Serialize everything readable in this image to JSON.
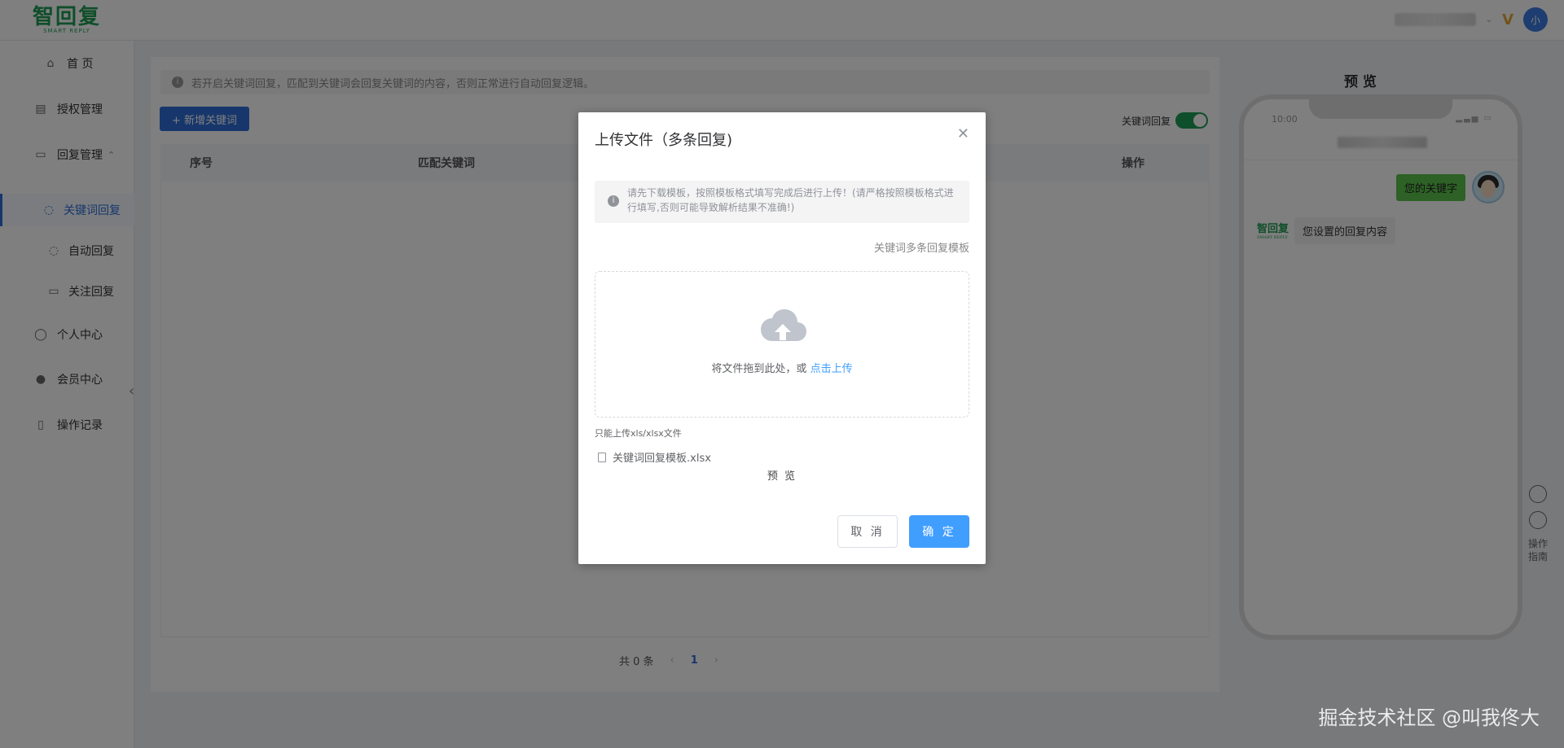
{
  "header": {
    "logo_text": "智回复",
    "logo_sub": "SMART REPLY",
    "avatar_text": "小"
  },
  "sidebar": {
    "items": [
      {
        "label": "首 页",
        "icon": "home-icon"
      },
      {
        "label": "授权管理",
        "icon": "document-icon"
      },
      {
        "label": "回复管理",
        "icon": "message-icon"
      },
      {
        "label": "关键词回复",
        "icon": "chat-icon"
      },
      {
        "label": "自动回复",
        "icon": "chat-icon"
      },
      {
        "label": "关注回复",
        "icon": "chat-icon"
      },
      {
        "label": "个人中心",
        "icon": "user-icon"
      },
      {
        "label": "会员中心",
        "icon": "member-icon"
      },
      {
        "label": "操作记录",
        "icon": "book-icon"
      }
    ]
  },
  "main": {
    "tip": "若开启关键词回复，匹配到关键词会回复关键词的内容，否则正常进行自动回复逻辑。",
    "add_button": "+ 新增关键词",
    "switch_label": "关键词回复",
    "table": {
      "col_index": "序号",
      "col_keyword": "匹配关键词",
      "col_action": "操作"
    },
    "pager": {
      "total": "共 0 条",
      "current": "1"
    }
  },
  "preview": {
    "title": "预 览",
    "time": "10:00",
    "msg_user": "您的关键字",
    "msg_reply": "您设置的回复内容",
    "logo_text": "智回复",
    "logo_sub": "SMART REPLY",
    "tool_label_1": "操作",
    "tool_label_2": "指南"
  },
  "dialog": {
    "title": "上传文件（多条回复)",
    "alert": "请先下载模板，按照模板格式填写完成后进行上传！(请严格按照模板格式进行填写,否则可能导致解析结果不准确!)",
    "template_link": "关键词多条回复模板",
    "drop_text": "将文件拖到此处，或 ",
    "drop_link": "点击上传",
    "hint": "只能上传xls/xlsx文件",
    "file_name": "关键词回复模板.xlsx",
    "preview": "预 览",
    "cancel": "取 消",
    "ok": "确 定"
  },
  "watermark": "掘金技术社区 @叫我佟大",
  "colors": {
    "primary": "#2f6fd8",
    "brand_green": "#1f9d55",
    "dialog_blue": "#409eff"
  }
}
